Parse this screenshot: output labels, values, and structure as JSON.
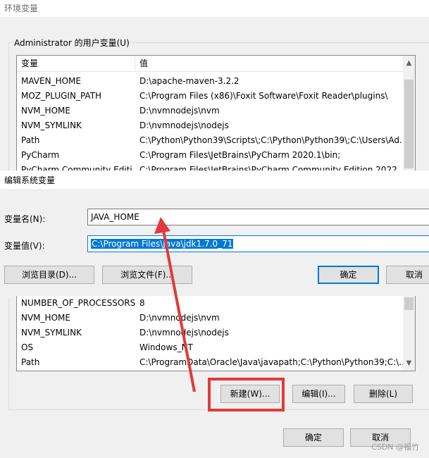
{
  "window": {
    "title": "环境变量"
  },
  "user_vars": {
    "group_label": "Administrator 的用户变量(U)",
    "col_name": "变量",
    "col_value": "值",
    "rows": [
      {
        "name": "MAVEN_HOME",
        "value": "D:\\apache-maven-3.2.2"
      },
      {
        "name": "MOZ_PLUGIN_PATH",
        "value": "C:\\Program Files (x86)\\Foxit Software\\Foxit Reader\\plugins\\"
      },
      {
        "name": "NVM_HOME",
        "value": "D:\\nvmnodejs\\nvm"
      },
      {
        "name": "NVM_SYMLINK",
        "value": "D:\\nvmnodejs\\nodejs"
      },
      {
        "name": "Path",
        "value": "C:\\Python\\Python39\\Scripts\\;C:\\Python\\Python39\\;C:\\Users\\Ad..."
      },
      {
        "name": "PyCharm",
        "value": "C:\\Program Files\\JetBrains\\PyCharm 2020.1\\bin;"
      },
      {
        "name": "PyCharm Community Editi...",
        "value": "C:\\Program Files\\JetBrains\\PyCharm Community Edition 2022..."
      }
    ]
  },
  "edit_dialog": {
    "title": "编辑系统变量",
    "name_label": "变量名(N):",
    "name_value": "JAVA_HOME",
    "value_label": "变量值(V):",
    "value_value": "C:\\Program Files\\Java\\jdk1.7.0_71",
    "browse_dir": "浏览目录(D)...",
    "browse_file": "浏览文件(F)...",
    "ok": "确定",
    "cancel": "取消"
  },
  "system_vars": {
    "rows": [
      {
        "name": "NUMBER_OF_PROCESSORS",
        "value": "8"
      },
      {
        "name": "NVM_HOME",
        "value": "D:\\nvmnodejs\\nvm"
      },
      {
        "name": "NVM_SYMLINK",
        "value": "D:\\nvmnodejs\\nodejs"
      },
      {
        "name": "OS",
        "value": "Windows_NT"
      },
      {
        "name": "Path",
        "value": "C:\\ProgramData\\Oracle\\Java\\javapath;C:\\Python\\Python39;C:\\..."
      }
    ],
    "new_btn": "新建(W)...",
    "edit_btn": "编辑(I)...",
    "delete_btn": "删除(L)"
  },
  "footer": {
    "ok": "确定",
    "cancel": "取消"
  },
  "watermark": "CSDN @福竹",
  "colors": {
    "accent": "#0078d7",
    "highlight": "#e23a3a"
  }
}
